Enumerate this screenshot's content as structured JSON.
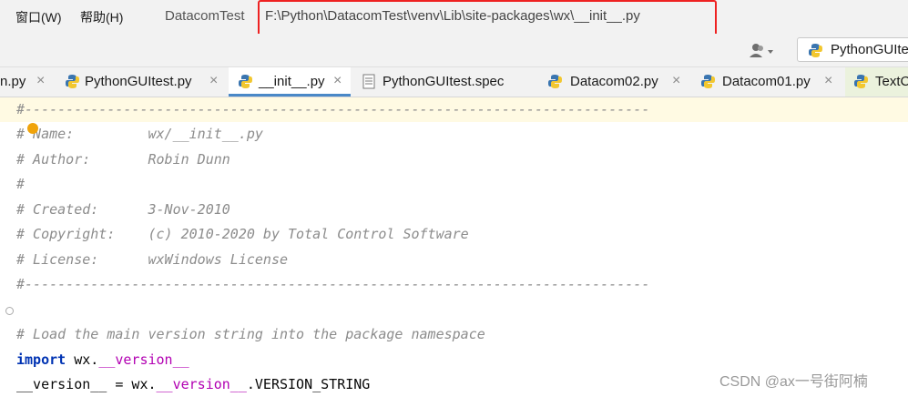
{
  "menu": [
    {
      "label": "窗口(W)"
    },
    {
      "label": "帮助(H)"
    }
  ],
  "project_name": "DatacomTest",
  "file_path": "F:\\Python\\DatacomTest\\venv\\Lib\\site-packages\\wx\\__init__.py",
  "run_config": {
    "label": "PythonGUIte",
    "icon": "python-icon"
  },
  "tabs": [
    {
      "label": "n.py",
      "icon": "python-icon"
    },
    {
      "label": "PythonGUItest.py",
      "icon": "python-icon"
    },
    {
      "label": "__init__.py",
      "icon": "python-icon",
      "active": true
    },
    {
      "label": "PythonGUItest.spec",
      "icon": "file-icon"
    },
    {
      "label": "Datacom02.py",
      "icon": "python-icon"
    },
    {
      "label": "Datacom01.py",
      "icon": "python-icon"
    },
    {
      "label": "TextC",
      "icon": "python-icon"
    }
  ],
  "close_glyph": "×",
  "code": [
    "#----------------------------------------------------------------------------",
    "# Name:         wx/__init__.py",
    "# Author:       Robin Dunn",
    "#",
    "# Created:      3-Nov-2010",
    "# Copyright:    (c) 2010-2020 by Total Control Software",
    "# License:      wxWindows License",
    "#----------------------------------------------------------------------------",
    "",
    "# Load the main version string into the package namespace",
    {
      "kw": "import",
      "rest": " wx.",
      "dunder": "__version__",
      "tail": ""
    },
    {
      "plain1": "__version__ = wx.",
      "dunder": "__version__",
      "plain2": ".VERSION_STRING"
    }
  ],
  "watermark": "CSDN @ax一号街阿楠"
}
